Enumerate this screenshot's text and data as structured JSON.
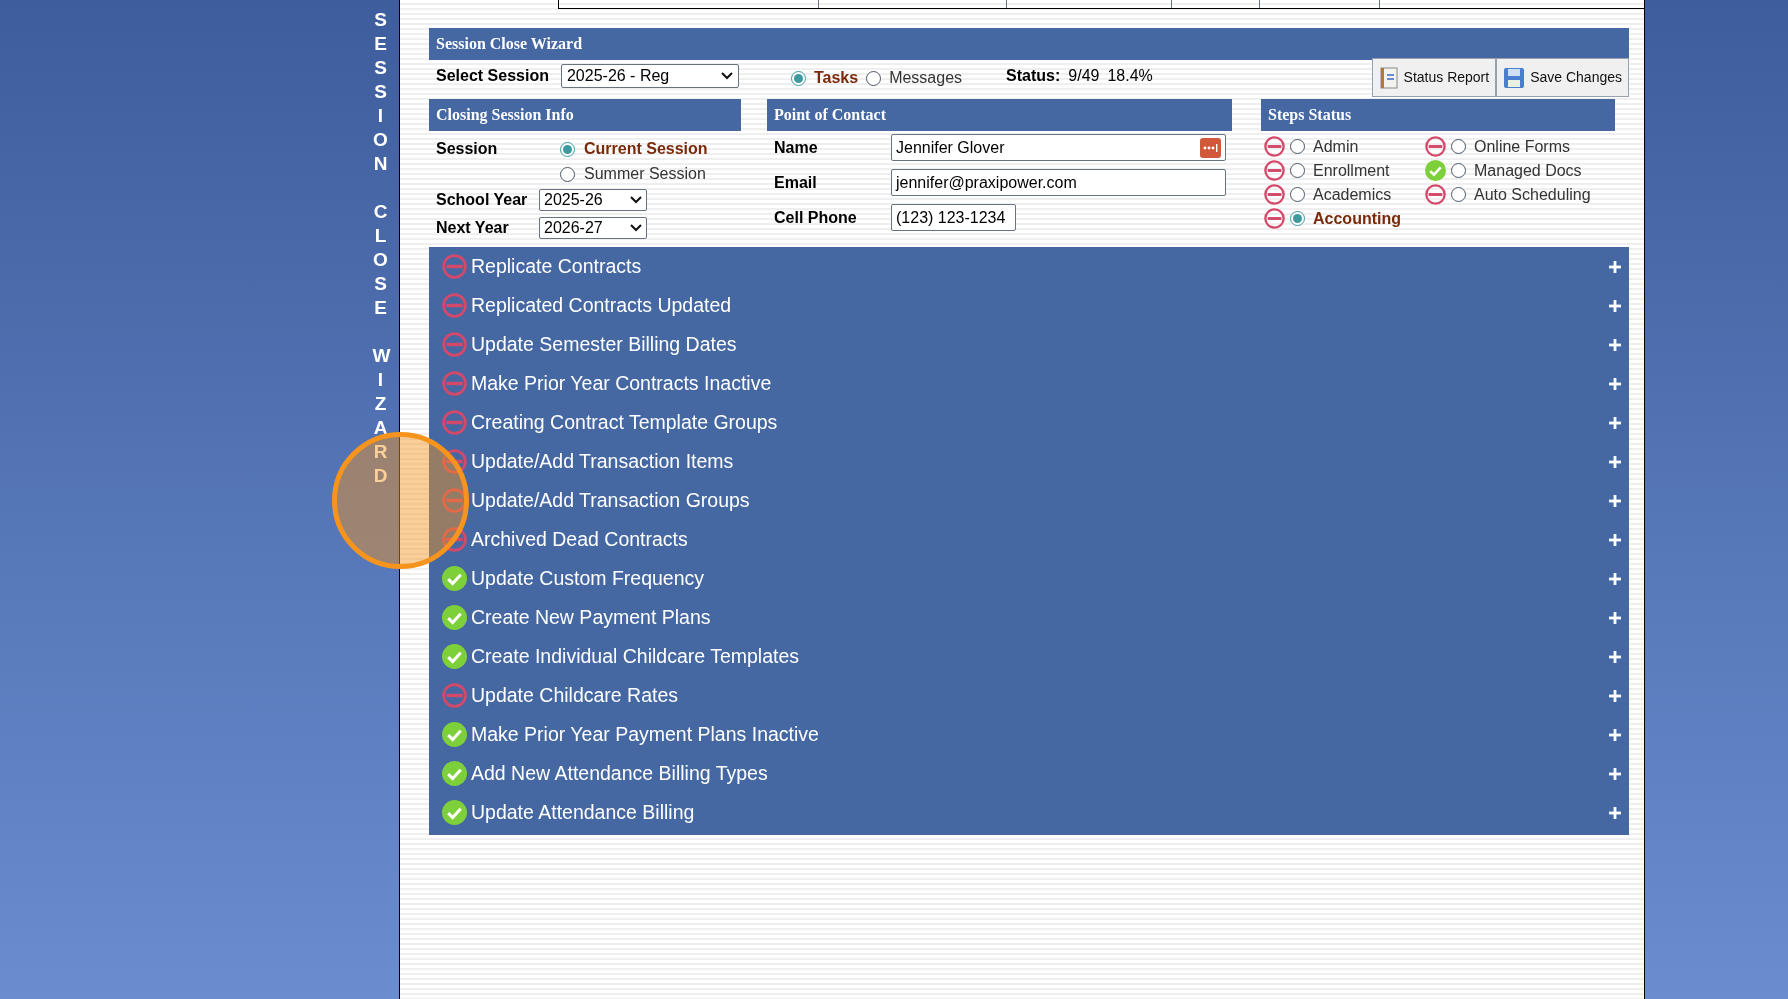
{
  "side_title": [
    "SESSION",
    "CLOSE",
    "WIZARD"
  ],
  "wizard": {
    "title": "Session Close Wizard",
    "select_session": {
      "label": "Select Session",
      "value": "2025-26 - Reg"
    },
    "view_options": [
      {
        "label": "Tasks",
        "selected": true
      },
      {
        "label": "Messages",
        "selected": false
      }
    ],
    "status": {
      "label": "Status:",
      "count": "9/49",
      "percent": "18.4%"
    },
    "buttons": [
      {
        "label": "Status Report",
        "kind": "report"
      },
      {
        "label": "Save Changes",
        "kind": "save"
      }
    ]
  },
  "closing_session_info": {
    "title": "Closing Session Info",
    "session_label": "Session",
    "session_options": [
      {
        "label": "Current Session",
        "selected": true
      },
      {
        "label": "Summer Session",
        "selected": false
      }
    ],
    "years": [
      {
        "label": "School Year",
        "value": "2025-26"
      },
      {
        "label": "Next Year",
        "value": "2026-27"
      }
    ]
  },
  "point_of_contact": {
    "title": "Point of Contact",
    "fields": [
      {
        "label": "Name",
        "value": "Jennifer Glover",
        "kind": "name"
      },
      {
        "label": "Email",
        "value": "jennifer@praxipower.com",
        "kind": "email"
      },
      {
        "label": "Cell Phone",
        "value": "(123) 123-1234",
        "kind": "phone"
      }
    ]
  },
  "steps_status": {
    "title": "Steps Status",
    "columns": [
      [
        {
          "label": "Admin",
          "done": false,
          "selected": false
        },
        {
          "label": "Enrollment",
          "done": false,
          "selected": false
        },
        {
          "label": "Academics",
          "done": false,
          "selected": false
        },
        {
          "label": "Accounting",
          "done": false,
          "selected": true
        }
      ],
      [
        {
          "label": "Online Forms",
          "done": false,
          "selected": false
        },
        {
          "label": "Managed Docs",
          "done": true,
          "selected": false
        },
        {
          "label": "Auto Scheduling",
          "done": false,
          "selected": false
        }
      ]
    ]
  },
  "tasks": [
    {
      "label": "Replicate Contracts",
      "done": false,
      "expanded": false
    },
    {
      "label": "Replicated Contracts Updated",
      "done": false,
      "expanded": false
    },
    {
      "label": "Update Semester Billing Dates",
      "done": false,
      "expanded": false
    },
    {
      "label": "Make Prior Year Contracts Inactive",
      "done": false,
      "expanded": false
    },
    {
      "label": "Creating Contract Template Groups",
      "done": false,
      "expanded": false
    },
    {
      "label": "Update/Add Transaction Items",
      "done": false,
      "expanded": false
    },
    {
      "label": "Update/Add Transaction Groups",
      "done": false,
      "expanded": false
    },
    {
      "label": "Archived Dead Contracts",
      "done": false,
      "expanded": false
    },
    {
      "label": "Update Custom Frequency",
      "done": true,
      "expanded": false
    },
    {
      "label": "Create New Payment Plans",
      "done": true,
      "expanded": false
    },
    {
      "label": "Create Individual Childcare Templates",
      "done": true,
      "expanded": false
    },
    {
      "label": "Update Childcare Rates",
      "done": false,
      "expanded": false
    },
    {
      "label": "Make Prior Year Payment Plans Inactive",
      "done": true,
      "expanded": false
    },
    {
      "label": "Add New Attendance Billing Types",
      "done": true,
      "expanded": false
    },
    {
      "label": "Update Attendance Billing",
      "done": true,
      "expanded": false
    }
  ]
}
